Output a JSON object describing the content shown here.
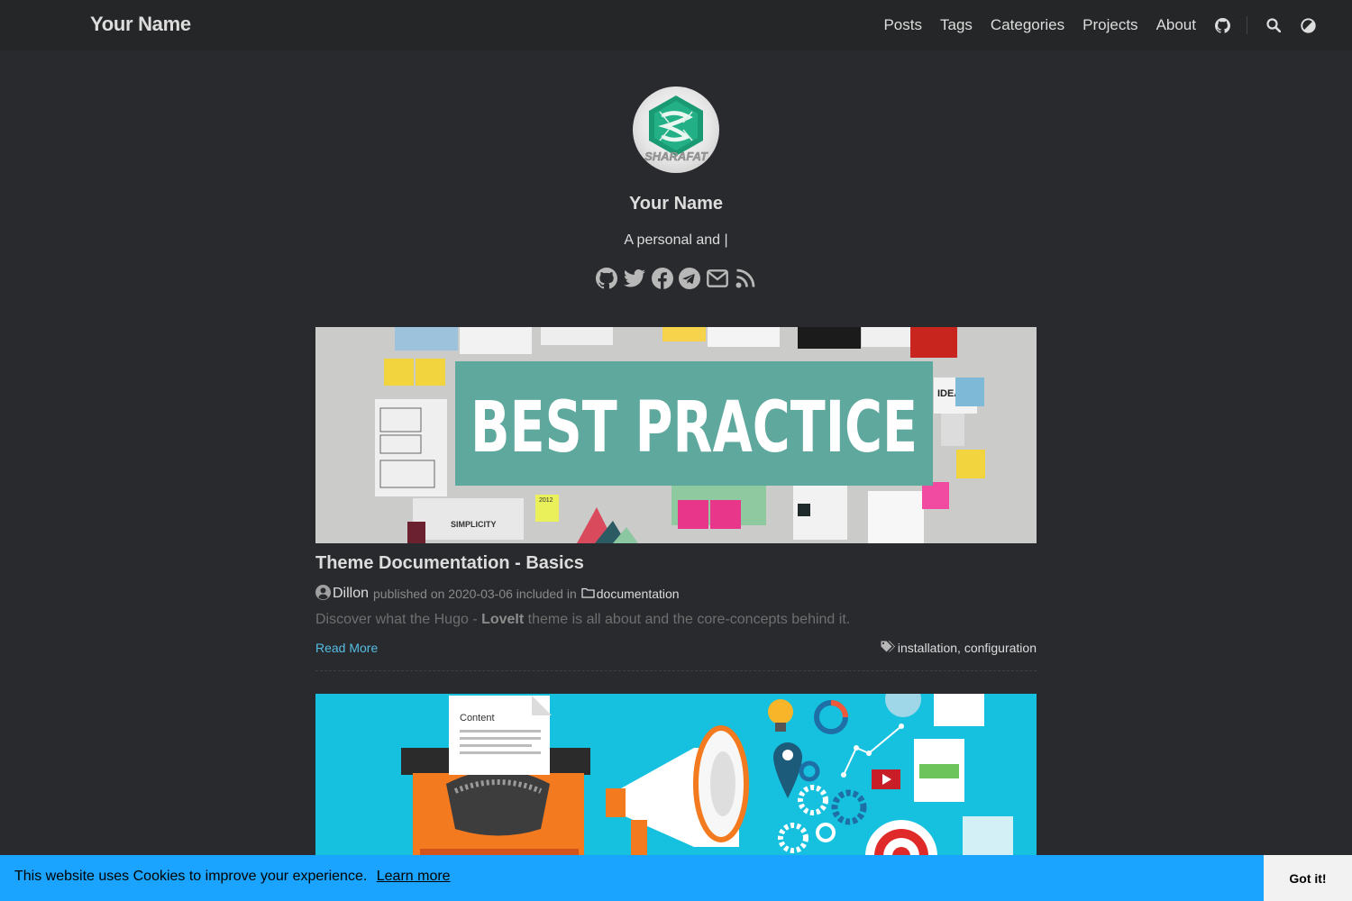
{
  "header": {
    "site_title": "Your Name",
    "nav": [
      "Posts",
      "Tags",
      "Categories",
      "Projects",
      "About"
    ],
    "icons": [
      "github-icon",
      "search-icon",
      "theme-toggle-icon"
    ]
  },
  "profile": {
    "avatar_text": "SHARAFAT",
    "name": "Your Name",
    "subtitle": "A personal and |",
    "social_icons": [
      "github-icon",
      "twitter-icon",
      "facebook-icon",
      "telegram-icon",
      "email-icon",
      "rss-icon"
    ]
  },
  "posts": [
    {
      "image_text": "BEST PRACTICE",
      "image_extra": [
        "SIMPLICITY",
        "IDEA",
        "2012"
      ],
      "title": "Theme Documentation - Basics",
      "author": "Dillon",
      "published": "published on 2020-03-06 included in",
      "category": "documentation",
      "summary_pre": "Discover what the Hugo - ",
      "summary_bold": "LoveIt",
      "summary_post": " theme is all about and the core-concepts behind it.",
      "read_more": "Read More",
      "tags": [
        "installation",
        "configuration"
      ]
    },
    {
      "image_text": "Content"
    }
  ],
  "cookie": {
    "message": "This website uses Cookies to improve your experience.",
    "link": "Learn more",
    "button": "Got it!"
  },
  "colors": {
    "background": "#292a2d",
    "header": "#252627",
    "link": "#55bde2",
    "cookie_bar": "#1aa3ff"
  }
}
